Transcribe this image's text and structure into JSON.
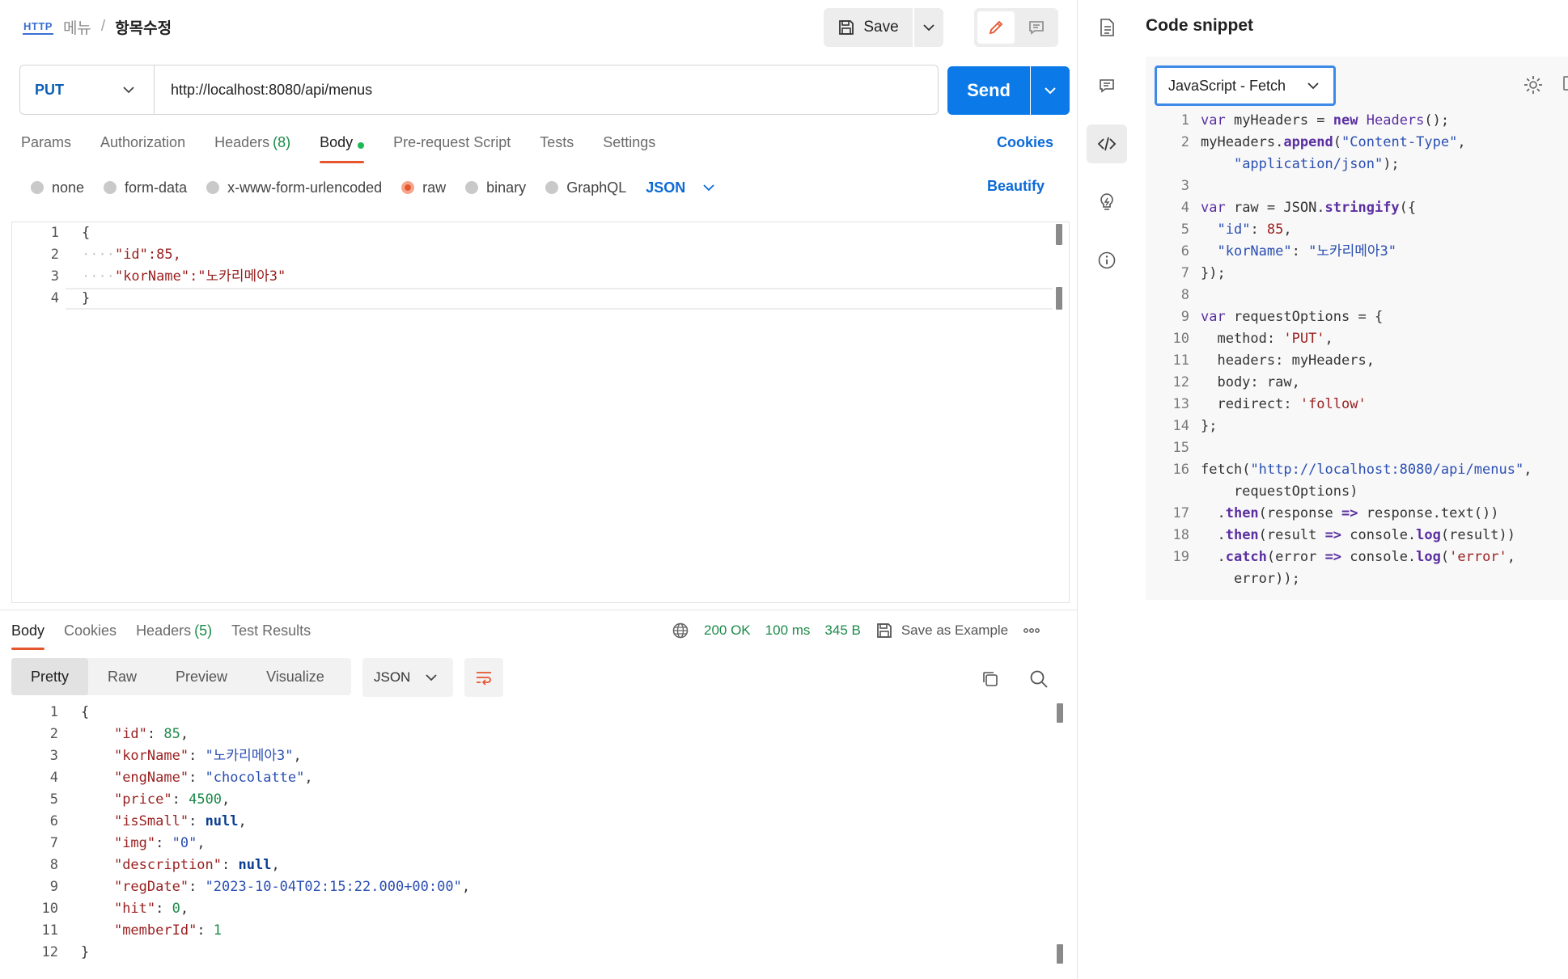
{
  "breadcrumb": {
    "protocol": "HTTP",
    "parent": "메뉴",
    "separator": "/",
    "current": "항목수정"
  },
  "toolbar": {
    "save_label": "Save"
  },
  "request": {
    "method": "PUT",
    "url": "http://localhost:8080/api/menus",
    "send_label": "Send"
  },
  "request_tabs": [
    {
      "label": "Params"
    },
    {
      "label": "Authorization"
    },
    {
      "label": "Headers",
      "count": "(8)"
    },
    {
      "label": "Body"
    },
    {
      "label": "Pre-request Script"
    },
    {
      "label": "Tests"
    },
    {
      "label": "Settings"
    }
  ],
  "cookies_label": "Cookies",
  "body_options": [
    {
      "label": "none",
      "selected": false
    },
    {
      "label": "form-data",
      "selected": false
    },
    {
      "label": "x-www-form-urlencoded",
      "selected": false
    },
    {
      "label": "raw",
      "selected": true
    },
    {
      "label": "binary",
      "selected": false
    },
    {
      "label": "GraphQL",
      "selected": false
    }
  ],
  "body_language": "JSON",
  "beautify_label": "Beautify",
  "request_body": {
    "line_numbers": [
      "1",
      "2",
      "3",
      "4"
    ],
    "lines": [
      "{",
      "\"id\":85,",
      "\"korName\":\"노카리메아3\"",
      "}"
    ]
  },
  "response_tabs": [
    {
      "label": "Body"
    },
    {
      "label": "Cookies"
    },
    {
      "label": "Headers",
      "count": "(5)"
    },
    {
      "label": "Test Results"
    }
  ],
  "response_status": {
    "code": "200 OK",
    "time": "100 ms",
    "size": "345 B",
    "save_example": "Save as Example"
  },
  "view_modes": [
    "Pretty",
    "Raw",
    "Preview",
    "Visualize"
  ],
  "response_format": "JSON",
  "response_body": {
    "line_numbers": [
      "1",
      "2",
      "3",
      "4",
      "5",
      "6",
      "7",
      "8",
      "9",
      "10",
      "11",
      "12"
    ],
    "fields": [
      {
        "key": "\"id\"",
        "value": "85",
        "kind": "num"
      },
      {
        "key": "\"korName\"",
        "value": "\"노카리메아3\"",
        "kind": "str"
      },
      {
        "key": "\"engName\"",
        "value": "\"chocolatte\"",
        "kind": "str"
      },
      {
        "key": "\"price\"",
        "value": "4500",
        "kind": "num"
      },
      {
        "key": "\"isSmall\"",
        "value": "null",
        "kind": "kw"
      },
      {
        "key": "\"img\"",
        "value": "\"0\"",
        "kind": "str"
      },
      {
        "key": "\"description\"",
        "value": "null",
        "kind": "kw"
      },
      {
        "key": "\"regDate\"",
        "value": "\"2023-10-04T02:15:22.000+00:00\"",
        "kind": "str"
      },
      {
        "key": "\"hit\"",
        "value": "0",
        "kind": "num"
      },
      {
        "key": "\"memberId\"",
        "value": "1",
        "kind": "num"
      }
    ]
  },
  "snippet": {
    "title": "Code snippet",
    "language": "JavaScript - Fetch",
    "line_numbers": [
      "1",
      "2",
      "",
      "3",
      "4",
      "5",
      "6",
      "7",
      "8",
      "9",
      "10",
      "11",
      "12",
      "13",
      "14",
      "15",
      "16",
      "",
      "17",
      "18",
      "19",
      ""
    ]
  },
  "icons": [
    "http-icon",
    "save-icon",
    "chevron-down-icon",
    "pencil-icon",
    "comment-icon",
    "document-icon",
    "comments-icon",
    "code-icon",
    "lightbulb-icon",
    "info-icon",
    "globe-icon",
    "copy-icon",
    "search-icon",
    "wrap-icon",
    "gear-icon",
    "more-icon"
  ],
  "colors": {
    "accent": "#e5552e",
    "primary": "#0b7ae8",
    "success": "#1d8a4a",
    "link": "#0c6ad8"
  }
}
